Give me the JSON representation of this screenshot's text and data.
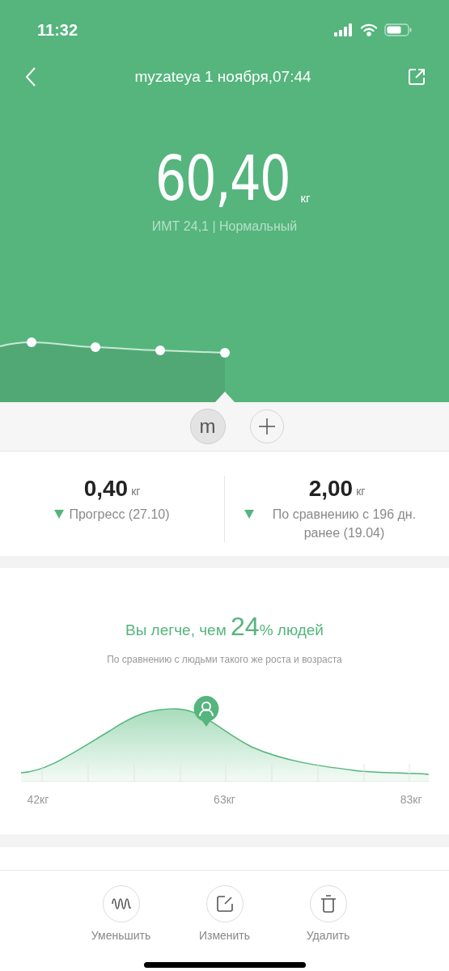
{
  "status_bar": {
    "time": "11:32"
  },
  "header": {
    "title": "myzateya 1 ноября,07:44"
  },
  "weight": {
    "value": "60,40",
    "unit": "кг",
    "bmi": "ИМТ 24,1 | Нормальный"
  },
  "profiles": [
    {
      "label": "m",
      "selected": true
    }
  ],
  "stats": [
    {
      "value": "0,40",
      "unit": "кг",
      "caption": "Прогресс (27.10)"
    },
    {
      "value": "2,00",
      "unit": "кг",
      "caption": "По сравнению с 196 дн. ранее (19.04)"
    }
  ],
  "comparison": {
    "headline_before": "Вы легче, чем ",
    "headline_number": "24",
    "headline_after": "% людей",
    "subtitle": "По сравнению с людьми такого же роста и возраста",
    "axis_labels": [
      "42кг",
      "63кг",
      "83кг"
    ]
  },
  "actions": [
    {
      "label": "Уменьшить",
      "kind": "wave"
    },
    {
      "label": "Изменить",
      "kind": "edit"
    },
    {
      "label": "Удалить",
      "kind": "delete"
    }
  ]
}
